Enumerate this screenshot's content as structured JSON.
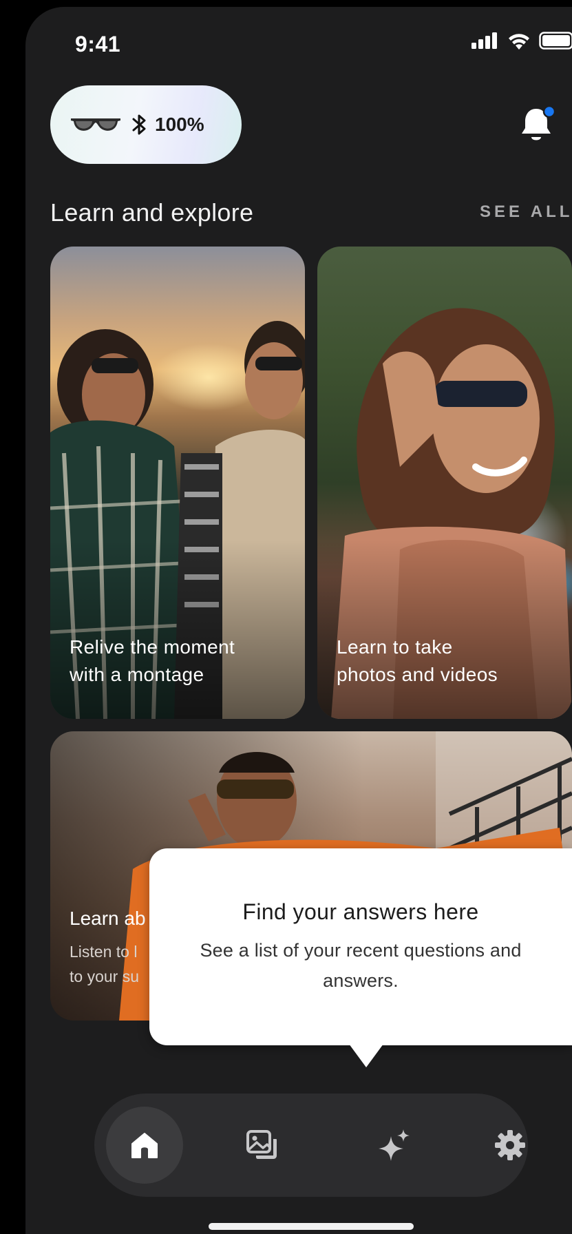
{
  "status_bar": {
    "time": "9:41"
  },
  "device": {
    "battery_label": "100%",
    "icons": [
      "glasses-icon",
      "bluetooth-icon"
    ]
  },
  "notifications": {
    "icon": "bell-icon",
    "has_unread": true,
    "dot_color": "#1877f2"
  },
  "section": {
    "title": "Learn and explore",
    "see_all": "SEE ALL"
  },
  "cards": [
    {
      "line1": "Relive the moment",
      "line2": "with a montage"
    },
    {
      "line1": "Learn to take",
      "line2": "photos and videos"
    }
  ],
  "wide_card": {
    "title": "Learn ab",
    "sub_line1": "Listen to l",
    "sub_line2": "to your su"
  },
  "tooltip": {
    "title": "Find your answers here",
    "body": "See a list of your recent questions and answers."
  },
  "bottom_nav": {
    "items": [
      {
        "icon": "home-icon",
        "active": true
      },
      {
        "icon": "gallery-icon",
        "active": false
      },
      {
        "icon": "sparkle-icon",
        "active": false
      },
      {
        "icon": "gear-icon",
        "active": false
      }
    ]
  },
  "colors": {
    "background": "#1d1d1e",
    "nav_bg": "#2c2c2e",
    "accent": "#1877f2"
  }
}
